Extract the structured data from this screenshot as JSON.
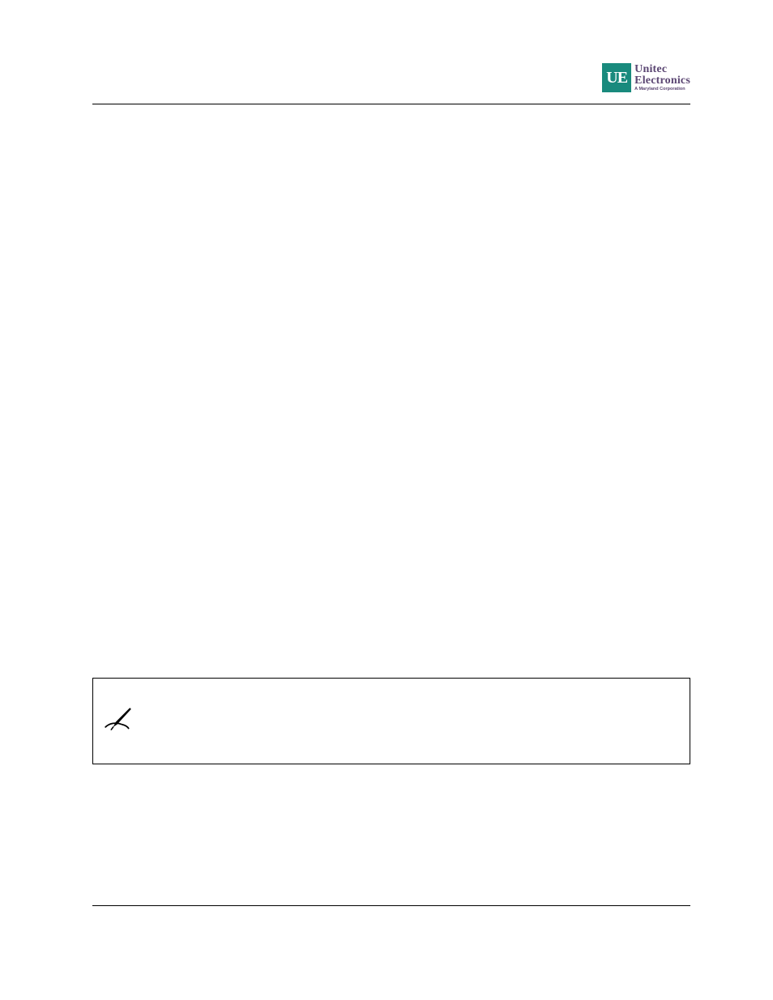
{
  "logo": {
    "square_text": "UE",
    "word_top": "Unitec",
    "word_bottom": "Electronics",
    "tagline": "A Maryland Corporation"
  }
}
